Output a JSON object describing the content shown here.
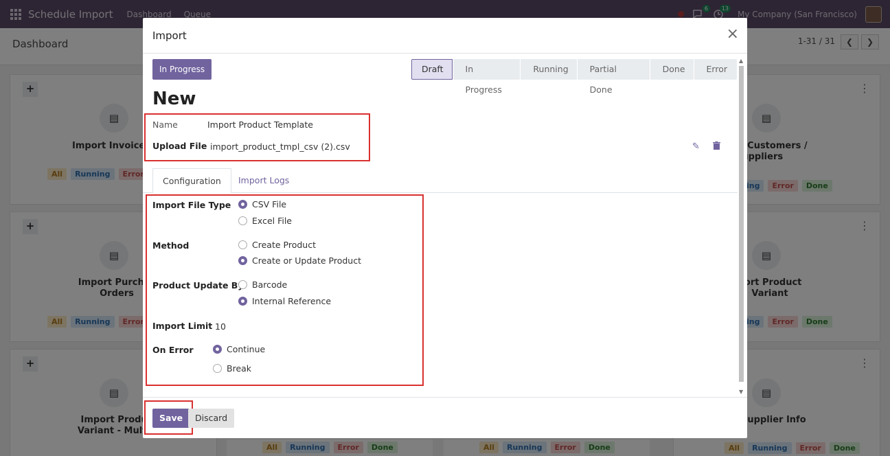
{
  "navbar": {
    "app_title": "Schedule Import",
    "menu": [
      "Dashboard",
      "Queue"
    ],
    "messages_count": "6",
    "activities_count": "13",
    "company": "My Company (San Francisco)"
  },
  "control_panel": {
    "breadcrumb": "Dashboard",
    "pager": "1-31 / 31",
    "prev": "❮",
    "next": "❯"
  },
  "cards": [
    {
      "title": "Import Invoice/B",
      "tags": [
        "All",
        "Running",
        "Error"
      ]
    },
    {
      "title": "rt Customers / Suppliers",
      "tags": [
        "ing",
        "Error",
        "Done"
      ]
    },
    {
      "title": "Import Purchas Orders",
      "tags": [
        "All",
        "Running",
        "Error"
      ]
    },
    {
      "title": "port Product Variant",
      "tags": [
        "ing",
        "Error",
        "Done"
      ]
    },
    {
      "title": "Import Produc Variant - Multip",
      "tags": []
    },
    {
      "title": "t Supplier Info",
      "tags": [
        "All",
        "Running",
        "Error",
        "Done"
      ]
    }
  ],
  "bottom_tags": [
    "All",
    "Running",
    "Error",
    "Done"
  ],
  "modal": {
    "title": "Import",
    "close": "×",
    "status_button": "In Progress",
    "stages": [
      "Draft",
      "In Progress",
      "Running",
      "Partial Done",
      "Done",
      "Error"
    ],
    "active_stage": "Draft",
    "record_name": "New",
    "fields": {
      "name_label": "Name",
      "name_value": "Import Product Template",
      "upload_label": "Upload File",
      "upload_value": "import_product_tmpl_csv (2).csv"
    },
    "tabs": [
      "Configuration",
      "Import Logs"
    ],
    "config": {
      "file_type_label": "Import File Type",
      "file_type_options": [
        "CSV File",
        "Excel File"
      ],
      "file_type_selected": "CSV File",
      "method_label": "Method",
      "method_options": [
        "Create Product",
        "Create or Update Product"
      ],
      "method_selected": "Create or Update Product",
      "update_by_label": "Product Update By",
      "update_by_options": [
        "Barcode",
        "Internal Reference"
      ],
      "update_by_selected": "Internal Reference",
      "limit_label": "Import Limit",
      "limit_value": "10",
      "on_error_label": "On Error",
      "on_error_options": [
        "Continue",
        "Break"
      ],
      "on_error_selected": "Continue"
    },
    "footer": {
      "save": "Save",
      "discard": "Discard"
    }
  }
}
